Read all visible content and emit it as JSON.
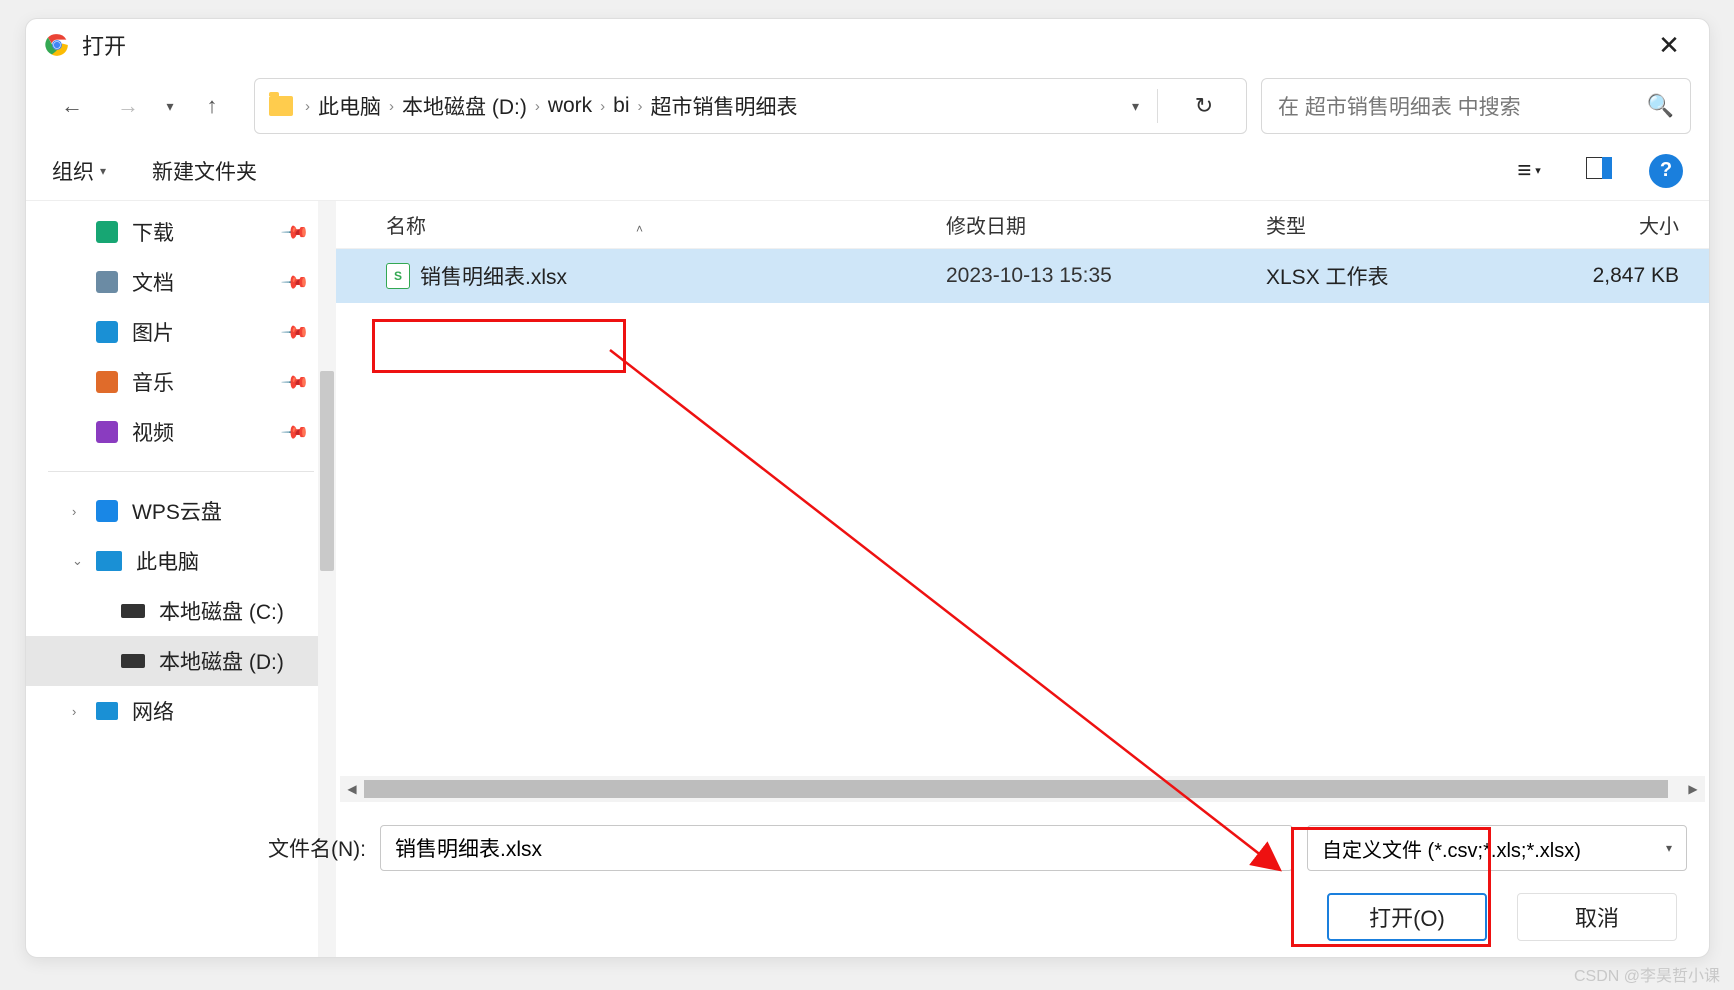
{
  "title": "打开",
  "breadcrumbs": [
    "此电脑",
    "本地磁盘 (D:)",
    "work",
    "bi",
    "超市销售明细表"
  ],
  "search_placeholder": "在 超市销售明细表 中搜索",
  "toolbar": {
    "organize": "组织",
    "newfolder": "新建文件夹"
  },
  "columns": {
    "name": "名称",
    "date": "修改日期",
    "type": "类型",
    "size": "大小"
  },
  "sidebar": {
    "quick": [
      "下载",
      "文档",
      "图片",
      "音乐",
      "视频"
    ],
    "wps": "WPS云盘",
    "pc": "此电脑",
    "disks": [
      "本地磁盘 (C:)",
      "本地磁盘 (D:)"
    ],
    "network": "网络"
  },
  "files": [
    {
      "name": "销售明细表.xlsx",
      "date": "2023-10-13 15:35",
      "type": "XLSX 工作表",
      "size": "2,847 KB"
    }
  ],
  "filename_label": "文件名(N):",
  "filename_value": "销售明细表.xlsx",
  "filetype_value": "自定义文件 (*.csv;*.xls;*.xlsx)",
  "open_button": "打开(O)",
  "cancel_button": "取消",
  "watermark": "CSDN @李昊哲小课"
}
